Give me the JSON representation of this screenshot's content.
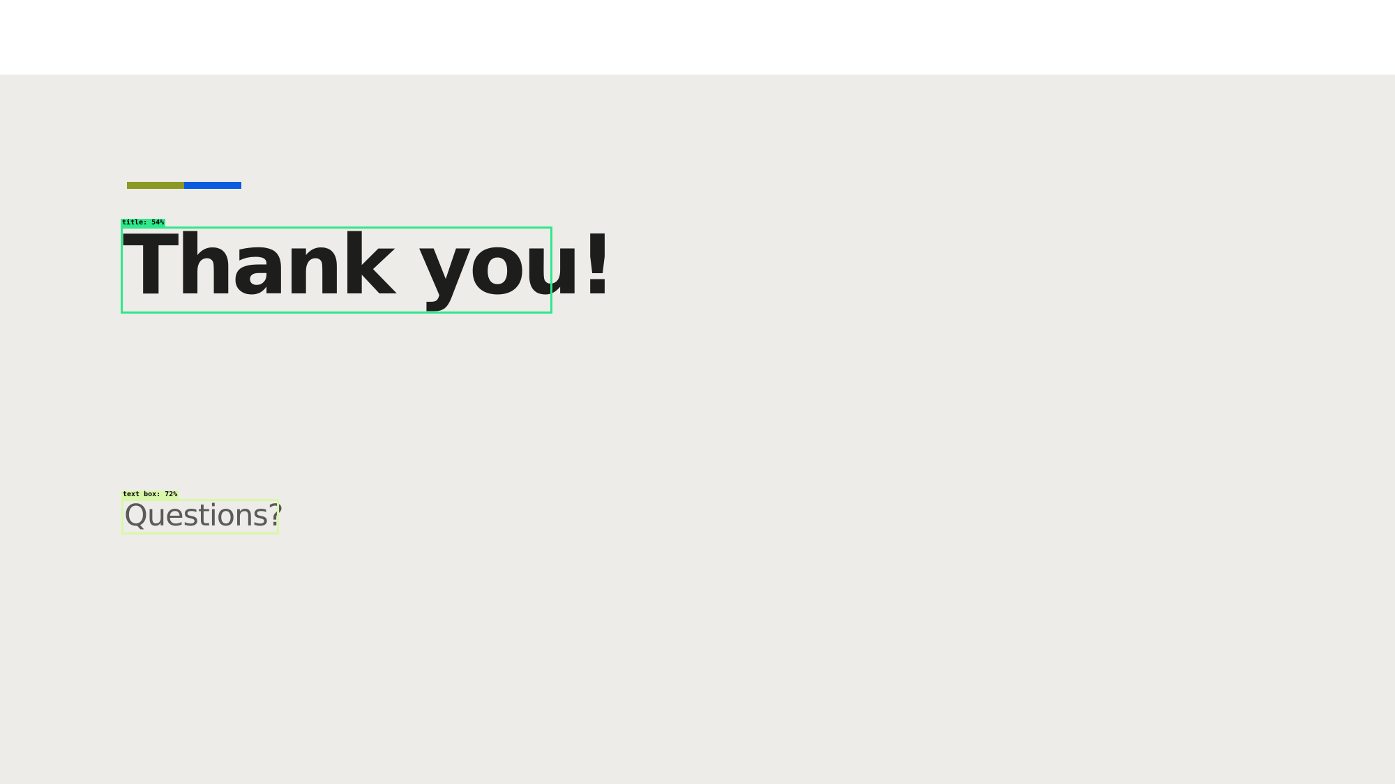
{
  "colors": {
    "accent_left": "#8a9a25",
    "accent_right": "#0b5be0",
    "title_box": "#2ee88b",
    "textbox_box": "#d9f7a8",
    "slide_background": "#edece8"
  },
  "slide": {
    "title": "Thank you!",
    "subtitle": "Questions?"
  },
  "detections": {
    "title_tag": "title: 54%",
    "textbox_tag": "text box: 72%"
  }
}
